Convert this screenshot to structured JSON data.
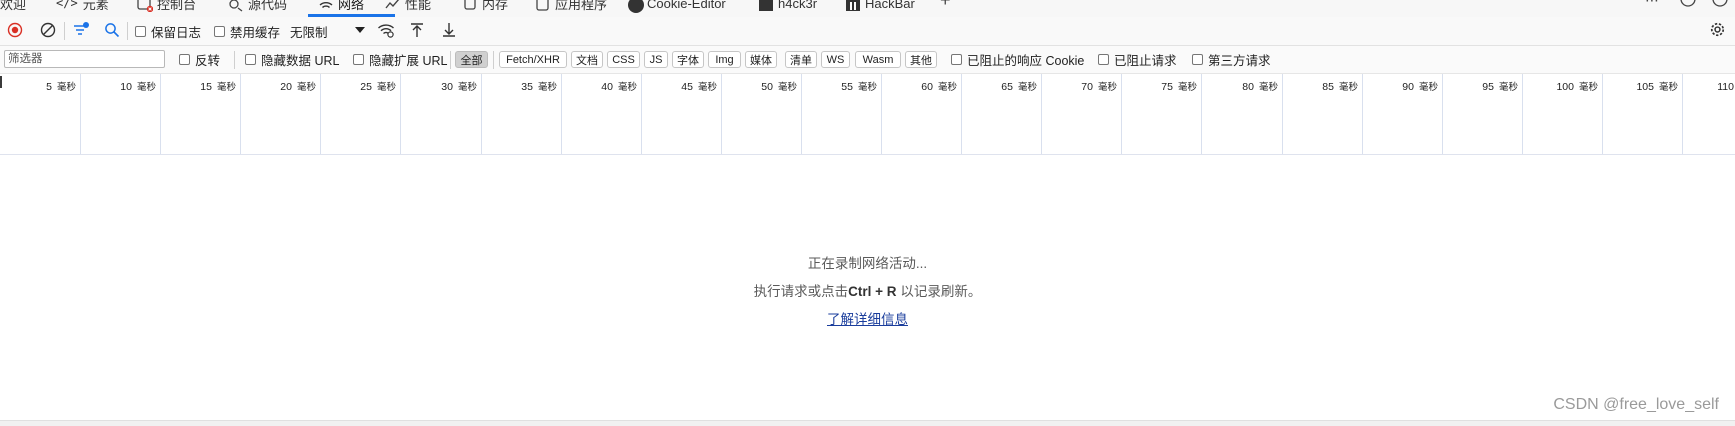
{
  "tabs": [
    {
      "label": "欢迎",
      "icon": "welcome-icon"
    },
    {
      "label": "元素",
      "icon": "elements-icon"
    },
    {
      "label": "控制台",
      "icon": "console-icon"
    },
    {
      "label": "源代码",
      "icon": "sources-icon"
    },
    {
      "label": "网络",
      "icon": "network-icon",
      "active": true
    },
    {
      "label": "性能",
      "icon": "performance-icon"
    },
    {
      "label": "内存",
      "icon": "memory-icon"
    },
    {
      "label": "应用程序",
      "icon": "application-icon"
    },
    {
      "label": "Cookie-Editor",
      "icon": "cookie-editor-icon"
    },
    {
      "label": "h4ck3r",
      "icon": "h4ck3r-icon"
    },
    {
      "label": "HackBar",
      "icon": "hackbar-icon"
    }
  ],
  "toolbar": {
    "preserve_log": "保留日志",
    "disable_cache": "禁用缓存",
    "throttling": "无限制"
  },
  "filters": {
    "placeholder": "筛选器",
    "invert": "反转",
    "hide_data_urls": "隐藏数据 URL",
    "hide_extension_urls": "隐藏扩展 URL",
    "types": [
      "全部",
      "Fetch/XHR",
      "文档",
      "CSS",
      "JS",
      "字体",
      "Img",
      "媒体",
      "清单",
      "WS",
      "Wasm",
      "其他"
    ],
    "blocked_cookies": "已阻止的响应 Cookie",
    "blocked_requests": "已阻止请求",
    "third_party": "第三方请求"
  },
  "timeline": {
    "unit": "毫秒",
    "ticks": [
      "5",
      "10",
      "15",
      "20",
      "25",
      "30",
      "35",
      "40",
      "45",
      "50",
      "55",
      "60",
      "65",
      "70",
      "75",
      "80",
      "85",
      "90",
      "95",
      "100",
      "105",
      "110"
    ]
  },
  "empty_state": {
    "recording": "正在录制网络活动...",
    "hint_prefix": "执行请求或点击",
    "shortcut": "Ctrl + R",
    "hint_suffix": "以记录刷新。",
    "learn_more": "了解详细信息"
  },
  "watermark": "CSDN @free_love_self",
  "colors": {
    "accent": "#1a73e8",
    "record": "#d93025",
    "link": "#1a3d9c"
  }
}
